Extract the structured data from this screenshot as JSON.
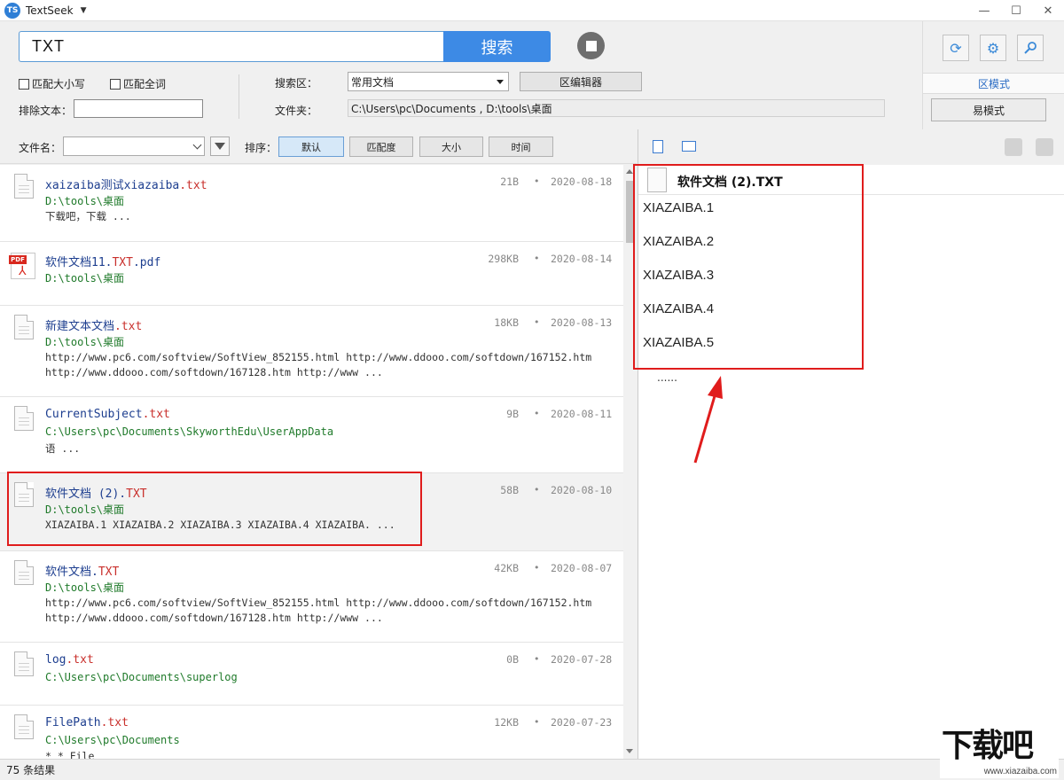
{
  "window": {
    "logo_text": "TS",
    "title": "TextSeek",
    "minimize": "—",
    "maximize": "☐",
    "close": "✕"
  },
  "search": {
    "query": "TXT",
    "button_label": "搜索"
  },
  "options": {
    "match_case_label": "匹配大小写",
    "match_whole_label": "匹配全词",
    "exclude_label": "排除文本：",
    "exclude_value": "",
    "search_zone_label": "搜索区：",
    "search_zone_value": "常用文档",
    "zone_editor_label": "区编辑器",
    "folder_label": "文件夹：",
    "folder_value": "C:\\Users\\pc\\Documents , D:\\tools\\桌面"
  },
  "right_panel": {
    "zone_mode_label": "区模式",
    "easy_mode_label": "易模式"
  },
  "filter": {
    "filename_label": "文件名：",
    "filename_value": "",
    "sort_label": "排序：",
    "sort_buttons": [
      "默认",
      "匹配度",
      "大小",
      "时间"
    ],
    "active_sort": "默认"
  },
  "results": [
    {
      "name": "xaizaiba测试xiazaiba",
      "ext": ".txt",
      "icon": "text-document-icon",
      "path": "D:\\tools\\桌面",
      "snippet": "下载吧，下载 ...",
      "size": "21B",
      "date": "2020-08-18"
    },
    {
      "name": "软件文档11.",
      "ext": "TXT",
      "ext2": ".pdf",
      "icon": "pdf-document-icon",
      "path": "D:\\tools\\桌面",
      "snippet": "",
      "size": "298KB",
      "date": "2020-08-14"
    },
    {
      "name": "新建文本文档",
      "ext": ".txt",
      "icon": "text-document-icon",
      "path": "D:\\tools\\桌面",
      "snippet": "http://www.pc6.com/softview/SoftView_852155.html http://www.ddooo.com/softdown/167152.htm\nhttp://www.ddooo.com/softdown/167128.htm http://www ...",
      "size": "18KB",
      "date": "2020-08-13"
    },
    {
      "name": "CurrentSubject",
      "ext": ".txt",
      "icon": "text-document-icon",
      "path": "C:\\Users\\pc\\Documents\\SkyworthEdu\\UserAppData",
      "snippet": "语 ...",
      "size": "9B",
      "date": "2020-08-11"
    },
    {
      "name": "软件文档 (2).",
      "ext": "TXT",
      "icon": "text-document-icon",
      "path": "D:\\tools\\桌面",
      "snippet": "XIAZAIBA.1 XIAZAIBA.2 XIAZAIBA.3 XIAZAIBA.4 XIAZAIBA. ...",
      "size": "58B",
      "date": "2020-08-10"
    },
    {
      "name": "软件文档.",
      "ext": "TXT",
      "icon": "text-document-icon",
      "path": "D:\\tools\\桌面",
      "snippet": "http://www.pc6.com/softview/SoftView_852155.html http://www.ddooo.com/softdown/167152.htm\nhttp://www.ddooo.com/softdown/167128.htm http://www ...",
      "size": "42KB",
      "date": "2020-08-07"
    },
    {
      "name": "log",
      "ext": ".txt",
      "icon": "text-document-icon",
      "path": "C:\\Users\\pc\\Documents\\superlog",
      "snippet": "",
      "size": "0B",
      "date": "2020-07-28"
    },
    {
      "name": "FilePath",
      "ext": ".txt",
      "icon": "text-document-icon",
      "path": "C:\\Users\\pc\\Documents",
      "snippet": "* * File",
      "size": "12KB",
      "date": "2020-07-23"
    }
  ],
  "preview": {
    "title": "软件文档 (2).TXT",
    "lines": [
      "XIAZAIBA.1",
      "XIAZAIBA.2",
      "XIAZAIBA.3",
      "XIAZAIBA.4",
      "XIAZAIBA.5"
    ],
    "ellipsis": "......"
  },
  "status": {
    "count_text": "75 条结果"
  },
  "watermark": {
    "brand": "下载吧",
    "url": "www.xiazaiba.com"
  },
  "colors": {
    "accent": "#3d8ae5",
    "filename": "#1d3e8f",
    "extension": "#c9302c",
    "path": "#1f7a2a",
    "highlight_box": "#e01c1c"
  }
}
